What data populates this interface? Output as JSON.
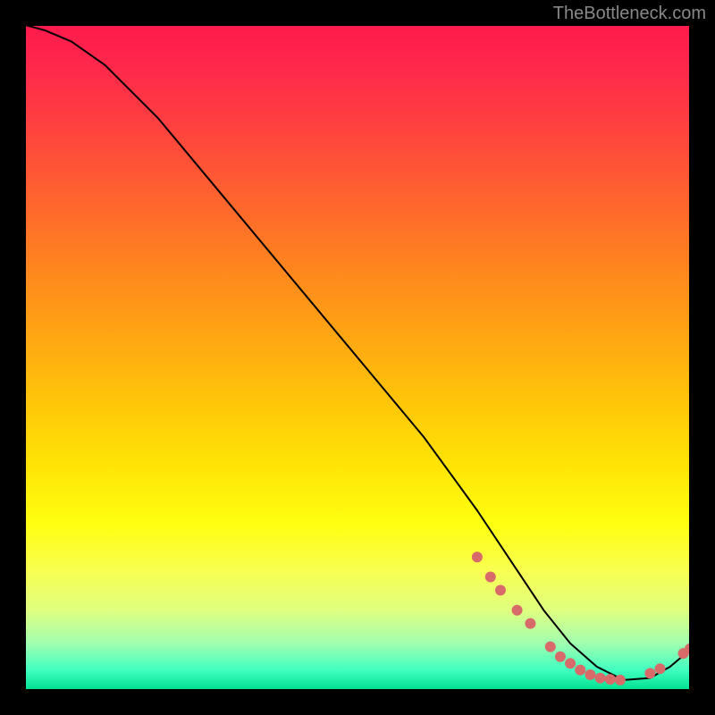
{
  "watermark": "TheBottleneck.com",
  "chart_data": {
    "type": "line",
    "title": "",
    "xlabel": "",
    "ylabel": "",
    "xlim": [
      0,
      100
    ],
    "ylim": [
      0,
      100
    ],
    "series": [
      {
        "name": "curve",
        "x": [
          0,
          3,
          7,
          12,
          20,
          30,
          40,
          50,
          60,
          68,
          74,
          78,
          82,
          86,
          90,
          94,
          97,
          100
        ],
        "y": [
          100,
          99.2,
          97.5,
          94,
          86,
          74,
          62,
          50,
          38,
          27,
          18,
          12,
          7,
          3.5,
          1.5,
          1.8,
          3.5,
          6
        ]
      }
    ],
    "markers": [
      {
        "x": 68,
        "y": 20,
        "color": "#d86a6a"
      },
      {
        "x": 70,
        "y": 17,
        "color": "#d86a6a"
      },
      {
        "x": 71.5,
        "y": 15,
        "color": "#d86a6a"
      },
      {
        "x": 74,
        "y": 12,
        "color": "#d86a6a"
      },
      {
        "x": 76,
        "y": 10,
        "color": "#d86a6a"
      },
      {
        "x": 79,
        "y": 6.5,
        "color": "#d86a6a"
      },
      {
        "x": 80.5,
        "y": 5,
        "color": "#d86a6a"
      },
      {
        "x": 82,
        "y": 4,
        "color": "#d86a6a"
      },
      {
        "x": 83.5,
        "y": 3,
        "color": "#d86a6a"
      },
      {
        "x": 85,
        "y": 2.3,
        "color": "#d86a6a"
      },
      {
        "x": 86.5,
        "y": 1.8,
        "color": "#d86a6a"
      },
      {
        "x": 88,
        "y": 1.6,
        "color": "#d86a6a"
      },
      {
        "x": 89.5,
        "y": 1.5,
        "color": "#d86a6a"
      },
      {
        "x": 94,
        "y": 2.5,
        "color": "#d86a6a"
      },
      {
        "x": 95.5,
        "y": 3.2,
        "color": "#d86a6a"
      },
      {
        "x": 99,
        "y": 5.5,
        "color": "#d86a6a"
      },
      {
        "x": 100,
        "y": 6.2,
        "color": "#d86a6a"
      }
    ]
  }
}
